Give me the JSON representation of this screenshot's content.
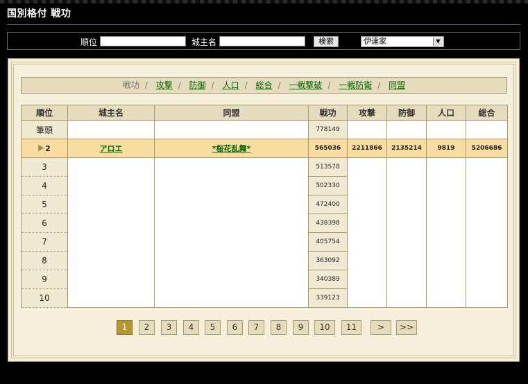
{
  "header": {
    "title": "国別格付 戦功"
  },
  "search": {
    "rank_label": "順位",
    "rank_value": "",
    "lord_label": "城主名",
    "lord_value": "",
    "search_button": "検索",
    "country_selected": "伊達家"
  },
  "tabs": [
    {
      "label": "戦功",
      "current": true
    },
    {
      "label": "攻撃"
    },
    {
      "label": "防御"
    },
    {
      "label": "人口"
    },
    {
      "label": "総合"
    },
    {
      "label": "一戦撃破"
    },
    {
      "label": "一戦防衛"
    },
    {
      "label": "同盟"
    }
  ],
  "table": {
    "headers": [
      "順位",
      "城主名",
      "同盟",
      "戦功",
      "攻撃",
      "防御",
      "人口",
      "総合"
    ],
    "rows": [
      {
        "rank": "筆頭",
        "lord": "",
        "alliance": "",
        "war": "778149",
        "atk": "",
        "def": "",
        "pop": "",
        "total": ""
      },
      {
        "rank": "2",
        "lord": "アロエ",
        "alliance": "*桜花乱舞*",
        "war": "565036",
        "atk": "2211866",
        "def": "2135214",
        "pop": "9819",
        "total": "5206686",
        "highlight": true
      },
      {
        "rank": "3",
        "war": "513578"
      },
      {
        "rank": "4",
        "war": "502330"
      },
      {
        "rank": "5",
        "war": "472400"
      },
      {
        "rank": "6",
        "war": "438398"
      },
      {
        "rank": "7",
        "war": "405754"
      },
      {
        "rank": "8",
        "war": "363092"
      },
      {
        "rank": "9",
        "war": "340389"
      },
      {
        "rank": "10",
        "war": "339123"
      }
    ]
  },
  "pager": {
    "pages": [
      "1",
      "2",
      "3",
      "4",
      "5",
      "6",
      "7",
      "8",
      "9",
      "10",
      "11"
    ],
    "active": "1",
    "next": ">",
    "last": ">>"
  }
}
